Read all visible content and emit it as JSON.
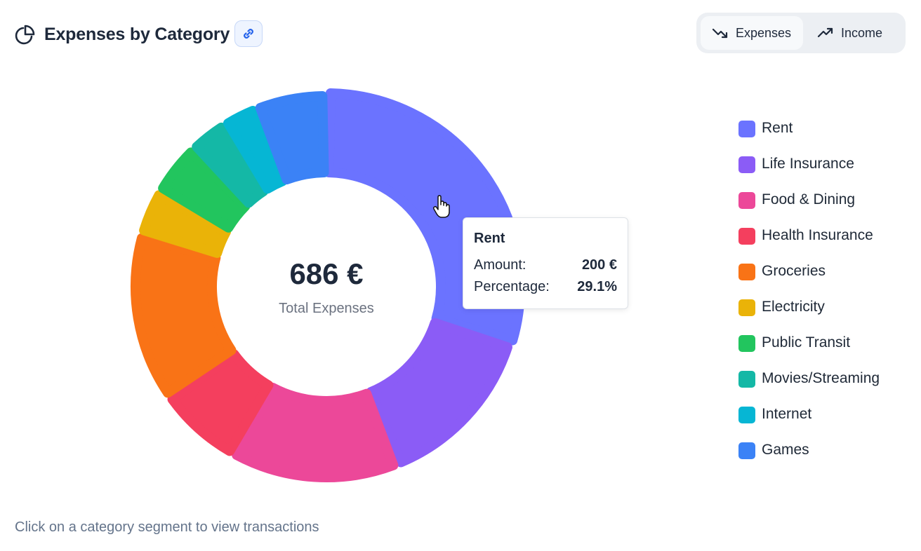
{
  "header": {
    "title": "Expenses by Category",
    "title_icon": "pie-chart-icon",
    "link_icon": "link-icon"
  },
  "toggle": {
    "expenses_label": "Expenses",
    "income_label": "Income",
    "expenses_icon": "trending-down-icon",
    "income_icon": "trending-up-icon",
    "active": "expenses"
  },
  "chart_data": {
    "type": "pie",
    "style": "donut",
    "categories": [
      "Rent",
      "Life Insurance",
      "Food & Dining",
      "Health Insurance",
      "Groceries",
      "Electricity",
      "Public Transit",
      "Movies/Streaming",
      "Internet",
      "Games"
    ],
    "values": [
      200,
      95,
      95,
      48,
      95,
      26,
      30,
      22,
      20,
      40
    ],
    "colors": [
      "#6b73ff",
      "#8b5cf6",
      "#ec4899",
      "#f43f5e",
      "#f97316",
      "#eab308",
      "#22c55e",
      "#14b8a6",
      "#06b6d4",
      "#3b82f6"
    ],
    "unit": "€",
    "legend_position": "right"
  },
  "center": {
    "value": "686 €",
    "label": "Total Expenses"
  },
  "tooltip": {
    "title": "Rent",
    "amount_label": "Amount:",
    "amount_value": "200 €",
    "percentage_label": "Percentage:",
    "percentage_value": "29.1%"
  },
  "footer": {
    "hint": "Click on a category segment to view transactions"
  }
}
